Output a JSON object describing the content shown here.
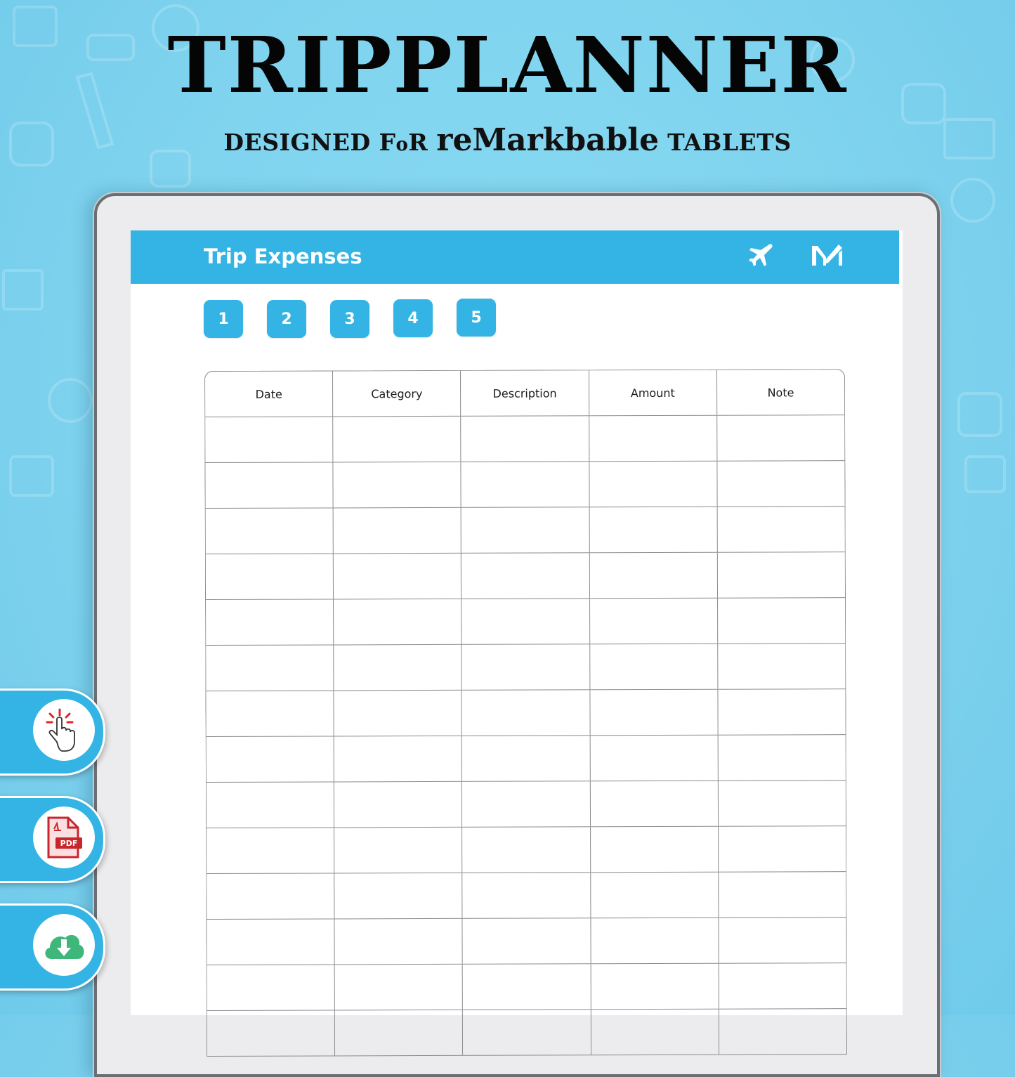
{
  "banner": {
    "title": "TRIPPLANNER",
    "subtitle_part1": "DESIGNED F",
    "subtitle_part2": "o",
    "subtitle_part3": "R ",
    "subtitle_brand": "reMarkbable",
    "subtitle_part4": " TABLETS"
  },
  "header": {
    "title": "Trip Expenses",
    "icons": [
      "airplane-icon",
      "brand-logo-icon"
    ]
  },
  "pages": [
    {
      "label": "1"
    },
    {
      "label": "2"
    },
    {
      "label": "3"
    },
    {
      "label": "4"
    },
    {
      "label": "5"
    }
  ],
  "table": {
    "columns": [
      "Date",
      "Category",
      "Description",
      "Amount",
      "Note"
    ],
    "rows": [
      [
        "",
        "",
        "",
        "",
        ""
      ],
      [
        "",
        "",
        "",
        "",
        ""
      ],
      [
        "",
        "",
        "",
        "",
        ""
      ],
      [
        "",
        "",
        "",
        "",
        ""
      ],
      [
        "",
        "",
        "",
        "",
        ""
      ],
      [
        "",
        "",
        "",
        "",
        ""
      ],
      [
        "",
        "",
        "",
        "",
        ""
      ],
      [
        "",
        "",
        "",
        "",
        ""
      ],
      [
        "",
        "",
        "",
        "",
        ""
      ],
      [
        "",
        "",
        "",
        "",
        ""
      ],
      [
        "",
        "",
        "",
        "",
        ""
      ],
      [
        "",
        "",
        "",
        "",
        ""
      ],
      [
        "",
        "",
        "",
        "",
        ""
      ],
      [
        "",
        "",
        "",
        "",
        ""
      ]
    ]
  },
  "side_features": [
    {
      "icon": "tap-hand-icon"
    },
    {
      "icon": "pdf-file-icon",
      "badge": "PDF"
    },
    {
      "icon": "cloud-download-icon"
    }
  ],
  "colors": {
    "accent": "#33b4e4",
    "background": "#7fd3ee",
    "tap_rays": "#e8202a",
    "pdf_red": "#c9252c",
    "download_green": "#3fb67a"
  }
}
